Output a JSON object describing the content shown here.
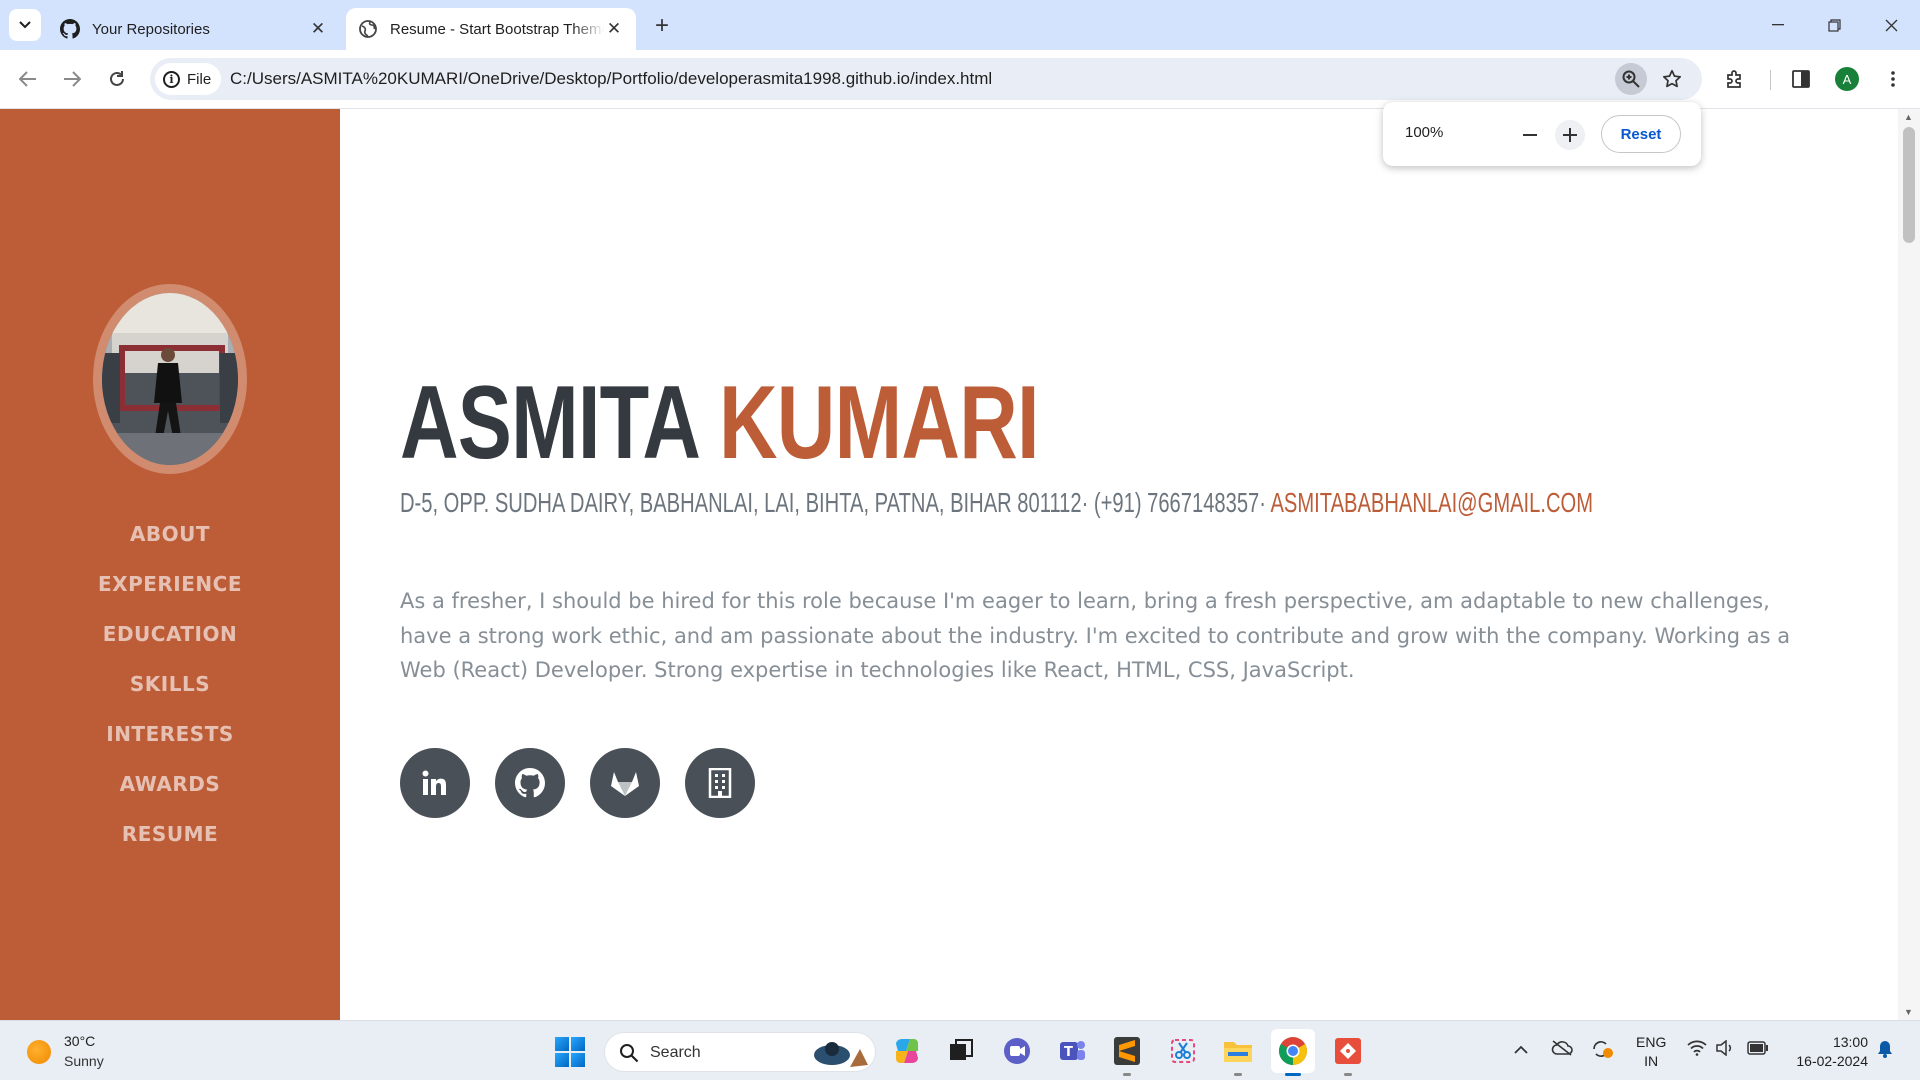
{
  "browser": {
    "tabs": [
      {
        "title": "Your Repositories",
        "active": false,
        "icon": "github-icon"
      },
      {
        "title": "Resume - Start Bootstrap Theme",
        "active": true,
        "icon": "globe-icon"
      }
    ],
    "address": {
      "scheme_chip": "File",
      "url": "C:/Users/ASMITA%20KUMARI/OneDrive/Desktop/Portfolio/developerasmita1998.github.io/index.html"
    },
    "profile_initial": "A",
    "zoom_popup": {
      "level": "100%",
      "reset_label": "Reset"
    }
  },
  "sidebar": {
    "accent_color": "#bd5d38",
    "nav": [
      "ABOUT",
      "EXPERIENCE",
      "EDUCATION",
      "SKILLS",
      "INTERESTS",
      "AWARDS",
      "RESUME"
    ]
  },
  "about": {
    "first_name": "ASMITA",
    "last_name": "KUMARI",
    "address_line": "D-5, OPP. SUDHA DAIRY, BABHANLAI, LAI, BIHTA, PATNA, BIHAR 801112· (+91) 7667148357·",
    "email": "ASMITABABHANLAI@GMAIL.COM",
    "lead": "As a fresher, I should be hired for this role because I'm eager to learn, bring a fresh perspective, am adaptable to new challenges, have a strong work ethic, and am passionate about the industry. I'm excited to contribute and grow with the company. Working as a Web (React) Developer. Strong expertise in technologies like React, HTML, CSS, JavaScript.",
    "social_icons": [
      "linkedin-icon",
      "github-icon",
      "gitlab-icon",
      "building-icon"
    ]
  },
  "taskbar": {
    "weather": {
      "temp": "30°C",
      "condition": "Sunny"
    },
    "search_label": "Search",
    "language": [
      "ENG",
      "IN"
    ],
    "time": "13:00",
    "date": "16-02-2024"
  }
}
